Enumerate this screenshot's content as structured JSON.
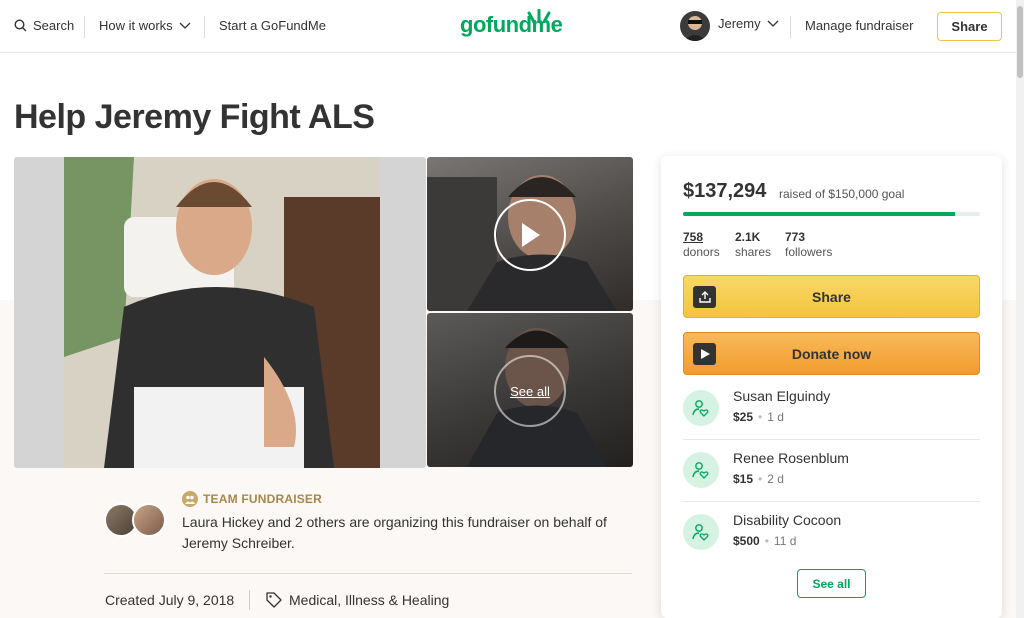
{
  "nav": {
    "search_label": "Search",
    "how_it_works_label": "How it works",
    "start_label": "Start a GoFundMe",
    "logo_text": "gofundme",
    "user_name": "Jeremy",
    "manage_label": "Manage fundraiser",
    "share_label": "Share",
    "icons": [
      "search-icon",
      "chevron-down-icon",
      "gofundme-logo-icon",
      "avatar",
      "chevron-down-icon"
    ]
  },
  "page": {
    "title": "Help Jeremy Fight ALS"
  },
  "media": {
    "see_all_label": "See all",
    "icons": [
      "play-icon"
    ]
  },
  "organizer": {
    "team_label": "TEAM FUNDRAISER",
    "description": "Laura Hickey and 2 others are organizing this fundraiser on behalf of Jeremy Schreiber.",
    "created": "Created July 9, 2018",
    "category": "Medical, Illness & Healing",
    "icons": [
      "team-icon",
      "tag-icon"
    ]
  },
  "donation": {
    "raised": "$137,294",
    "goal_text": "raised of $150,000 goal",
    "progress_fraction": 0.915,
    "stats": [
      {
        "value": "758",
        "label": "donors"
      },
      {
        "value": "2.1K",
        "label": "shares"
      },
      {
        "value": "773",
        "label": "followers"
      }
    ],
    "share_label": "Share",
    "donate_label": "Donate now",
    "donors": [
      {
        "name": "Susan Elguindy",
        "amount": "$25",
        "time": "1 d"
      },
      {
        "name": "Renee Rosenblum",
        "amount": "$15",
        "time": "2 d"
      },
      {
        "name": "Disability Cocoon",
        "amount": "$500",
        "time": "11 d"
      }
    ],
    "see_all_label": "See all",
    "icons": [
      "share-icon",
      "play-icon",
      "donor-heart-icon"
    ]
  },
  "colors": {
    "brand_green": "#02a95c",
    "share_yellow": "#f2c53d",
    "donate_orange": "#f39c2c",
    "team_gold": "#a8884a"
  }
}
